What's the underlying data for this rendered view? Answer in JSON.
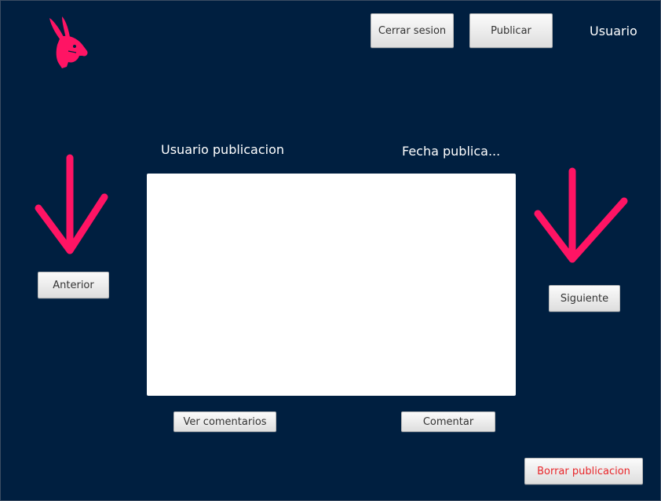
{
  "header": {
    "logout_label": "Cerrar sesion",
    "publish_label": "Publicar",
    "username": "Usuario"
  },
  "post": {
    "author_label": "Usuario publicacion",
    "date_label": "Fecha publica..."
  },
  "navigation": {
    "previous_label": "Anterior",
    "next_label": "Siguiente"
  },
  "actions": {
    "view_comments_label": "Ver comentarios",
    "comment_label": "Comentar",
    "delete_post_label": "Borrar publicacion"
  },
  "icons": {
    "logo": "rabbit-logo-icon",
    "previous_arrow": "arrow-down-icon",
    "next_arrow": "arrow-down-icon"
  },
  "colors": {
    "background": "#001f40",
    "accent": "#ff1464",
    "danger_text": "#e8262a",
    "label_text": "#ffffff"
  }
}
